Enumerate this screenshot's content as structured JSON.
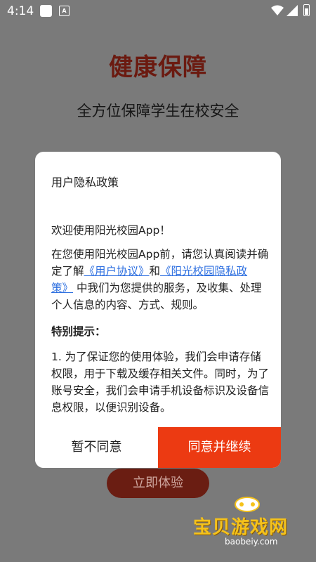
{
  "status_bar": {
    "time": "4:14",
    "icons": [
      "notification-square-icon",
      "a-icon",
      "wifi-icon",
      "signal-icon",
      "battery-icon"
    ]
  },
  "app": {
    "title": "健康保障",
    "subtitle": "全方位保障学生在校安全",
    "experience_button": "立即体验"
  },
  "dialog": {
    "title": "用户隐私政策",
    "welcome": "欢迎使用阳光校园App！",
    "intro_part1": "在您使用阳光校园App前，请您认真阅读并确定了解",
    "link_user_agreement": "《用户协议》",
    "and": "和",
    "link_privacy_policy": "《阳光校园隐私政策》",
    "intro_part2": " 中我们为您提供的服务，及收集、处理个人信息的内容、方式、规则。",
    "special_heading": "特别提示：",
    "special_item1": "1. 为了保证您的使用体验，我们会申请存储权限，用于下载及缓存相关文件。同时，为了账号安全，我们会申请手机设备标识及设备信息权限，以便识别设备。",
    "disagree_button": "暂不同意",
    "agree_button": "同意并继续"
  },
  "watermark": {
    "text": "宝贝游戏网",
    "url": "baobeiy.com"
  },
  "colors": {
    "overlay_bg": "#7a7a7a",
    "title_color": "#6b1a10",
    "agree_bg": "#ec3a12",
    "link": "#2d6fe0"
  }
}
